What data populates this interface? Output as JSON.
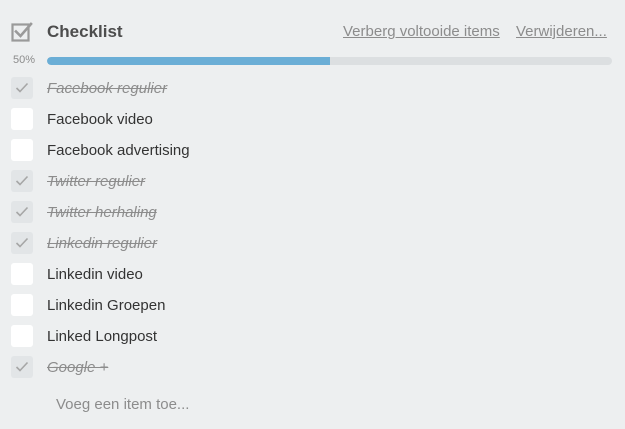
{
  "checklist": {
    "title": "Checklist",
    "hide_completed_label": "Verberg voltooide items",
    "delete_label": "Verwijderen...",
    "progress_label": "50%",
    "progress_fraction": 0.5,
    "accent_color": "#6baed6",
    "items": [
      {
        "label": "Facebook regulier",
        "done": true
      },
      {
        "label": "Facebook video",
        "done": false
      },
      {
        "label": "Facebook advertising",
        "done": false
      },
      {
        "label": "Twitter regulier",
        "done": true
      },
      {
        "label": "Twitter herhaling",
        "done": true
      },
      {
        "label": "Linkedin regulier",
        "done": true
      },
      {
        "label": "Linkedin video",
        "done": false
      },
      {
        "label": "Linkedin Groepen",
        "done": false
      },
      {
        "label": "Linked Longpost",
        "done": false
      },
      {
        "label": "Google +",
        "done": true
      }
    ],
    "add_item_label": "Voeg een item toe..."
  }
}
